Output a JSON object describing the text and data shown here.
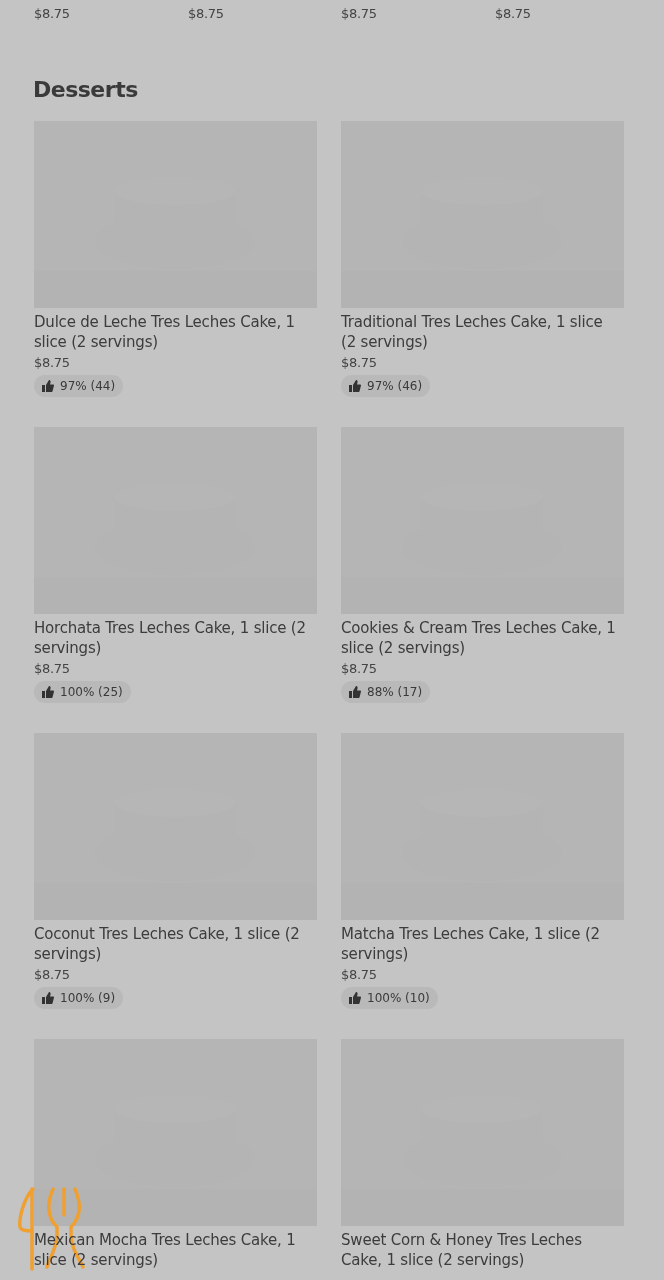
{
  "previous_row": {
    "prices": [
      "$8.75",
      "$8.75",
      "$8.75",
      "$8.75"
    ]
  },
  "section": {
    "title": "Desserts",
    "items": [
      {
        "name": "Dulce de Leche Tres Leches Cake, 1 slice (2 servings)",
        "price": "$8.75",
        "rating": "97% (44)"
      },
      {
        "name": "Traditional Tres Leches Cake, 1 slice (2 servings)",
        "price": "$8.75",
        "rating": "97% (46)"
      },
      {
        "name": "Horchata Tres Leches Cake, 1 slice (2 servings)",
        "price": "$8.75",
        "rating": "100% (25)"
      },
      {
        "name": "Cookies & Cream Tres Leches Cake, 1 slice (2 servings)",
        "price": "$8.75",
        "rating": "88% (17)"
      },
      {
        "name": "Coconut Tres Leches Cake, 1 slice (2 servings)",
        "price": "$8.75",
        "rating": "100% (9)"
      },
      {
        "name": "Matcha Tres Leches Cake, 1 slice (2 servings)",
        "price": "$8.75",
        "rating": "100% (10)"
      },
      {
        "name": "Mexican Mocha Tres Leches Cake, 1 slice (2 servings)"
      },
      {
        "name": "Sweet Corn & Honey Tres Leches Cake, 1 slice (2 servings)"
      }
    ]
  }
}
